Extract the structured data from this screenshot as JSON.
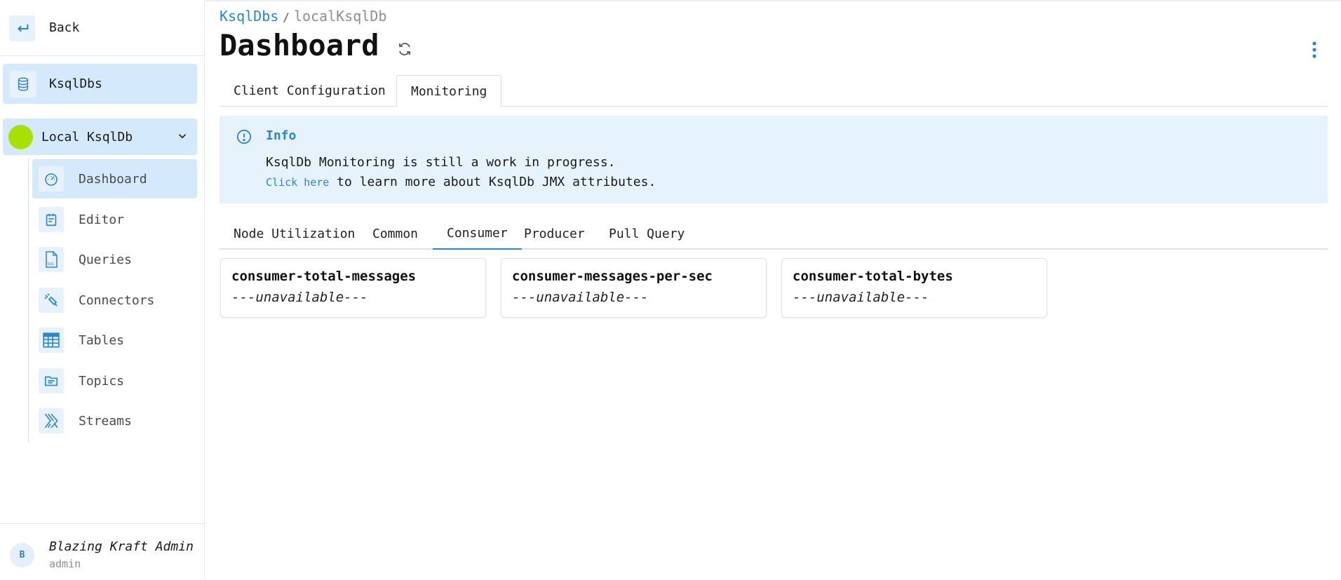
{
  "sidebar": {
    "back_label": "Back",
    "top_item_label": "KsqlDbs",
    "connection": {
      "label": "Local KsqlDb",
      "status_color": "#a8e000"
    },
    "items": [
      {
        "label": "Dashboard",
        "icon": "gauge-icon"
      },
      {
        "label": "Editor",
        "icon": "calendar-note-icon"
      },
      {
        "label": "Queries",
        "icon": "sql-file-icon"
      },
      {
        "label": "Connectors",
        "icon": "connector-icon"
      },
      {
        "label": "Tables",
        "icon": "table-icon"
      },
      {
        "label": "Topics",
        "icon": "folder-icon"
      },
      {
        "label": "Streams",
        "icon": "streams-icon"
      }
    ],
    "user": {
      "initial": "B",
      "name": "Blazing Kraft Admin",
      "role": "admin"
    }
  },
  "breadcrumb": {
    "parent": "KsqlDbs",
    "separator": "/",
    "current": "localKsqlDb"
  },
  "page_title": "Dashboard",
  "tabs": [
    {
      "label": "Client Configuration",
      "active": false
    },
    {
      "label": "Monitoring",
      "active": true
    }
  ],
  "info": {
    "title": "Info",
    "line1": "KsqlDb Monitoring is still a work in progress.",
    "link": "Click here",
    "line2_rest": " to learn more about KsqlDb JMX attributes."
  },
  "metric_tabs": [
    {
      "label": "Node Utilization",
      "active": false
    },
    {
      "label": "Common",
      "active": false
    },
    {
      "label": "Consumer",
      "active": true
    },
    {
      "label": "Producer",
      "active": false
    },
    {
      "label": "Pull Query",
      "active": false
    }
  ],
  "metrics": [
    {
      "name": "consumer-total-messages",
      "value": "---unavailable---"
    },
    {
      "name": "consumer-messages-per-sec",
      "value": "---unavailable---"
    },
    {
      "name": "consumer-total-bytes",
      "value": "---unavailable---"
    }
  ],
  "colors": {
    "accent": "#2b86cf",
    "active_bg": "#d4e9fc",
    "info_bg": "#e6f3fd"
  }
}
